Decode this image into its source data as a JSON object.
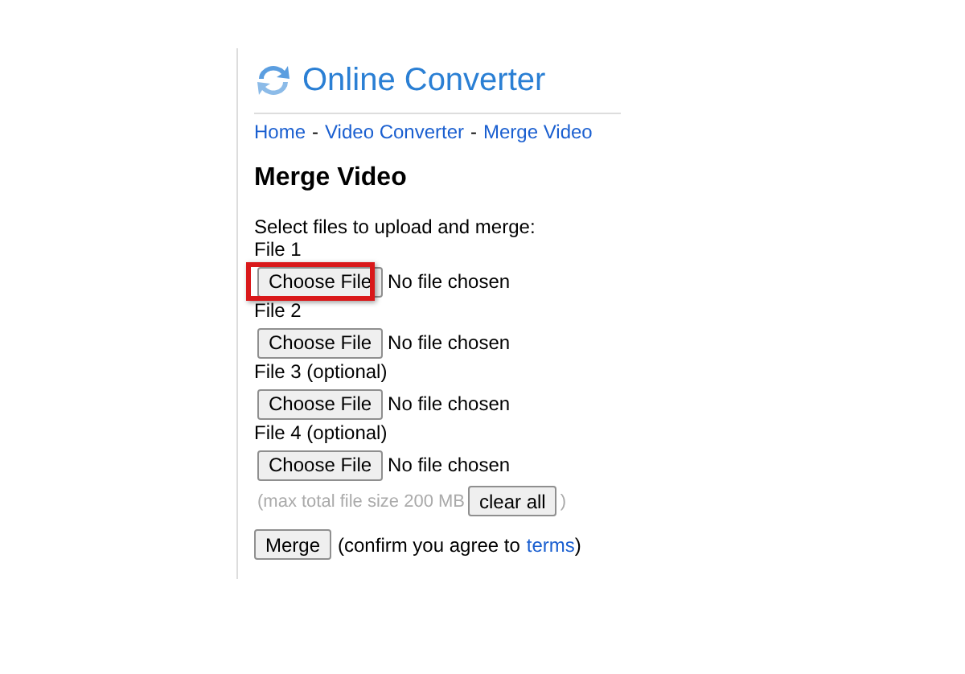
{
  "logo": {
    "title": "Online Converter"
  },
  "breadcrumb": {
    "separator": "-",
    "items": [
      "Home",
      "Video Converter",
      "Merge Video"
    ]
  },
  "heading": "Merge Video",
  "instructions": "Select files to upload and merge:",
  "files": [
    {
      "label": "File 1",
      "button": "Choose File",
      "status": "No file chosen",
      "highlighted": true
    },
    {
      "label": "File 2",
      "button": "Choose File",
      "status": "No file chosen",
      "highlighted": false
    },
    {
      "label": "File 3 (optional)",
      "button": "Choose File",
      "status": "No file chosen",
      "highlighted": false
    },
    {
      "label": "File 4 (optional)",
      "button": "Choose File",
      "status": "No file chosen",
      "highlighted": false
    }
  ],
  "limit": {
    "note": "(max total file size 200 MB",
    "button": "clear all",
    "close": ")"
  },
  "submit": {
    "button": "Merge",
    "note": "(confirm you agree to",
    "link": "terms",
    "close": ")"
  }
}
